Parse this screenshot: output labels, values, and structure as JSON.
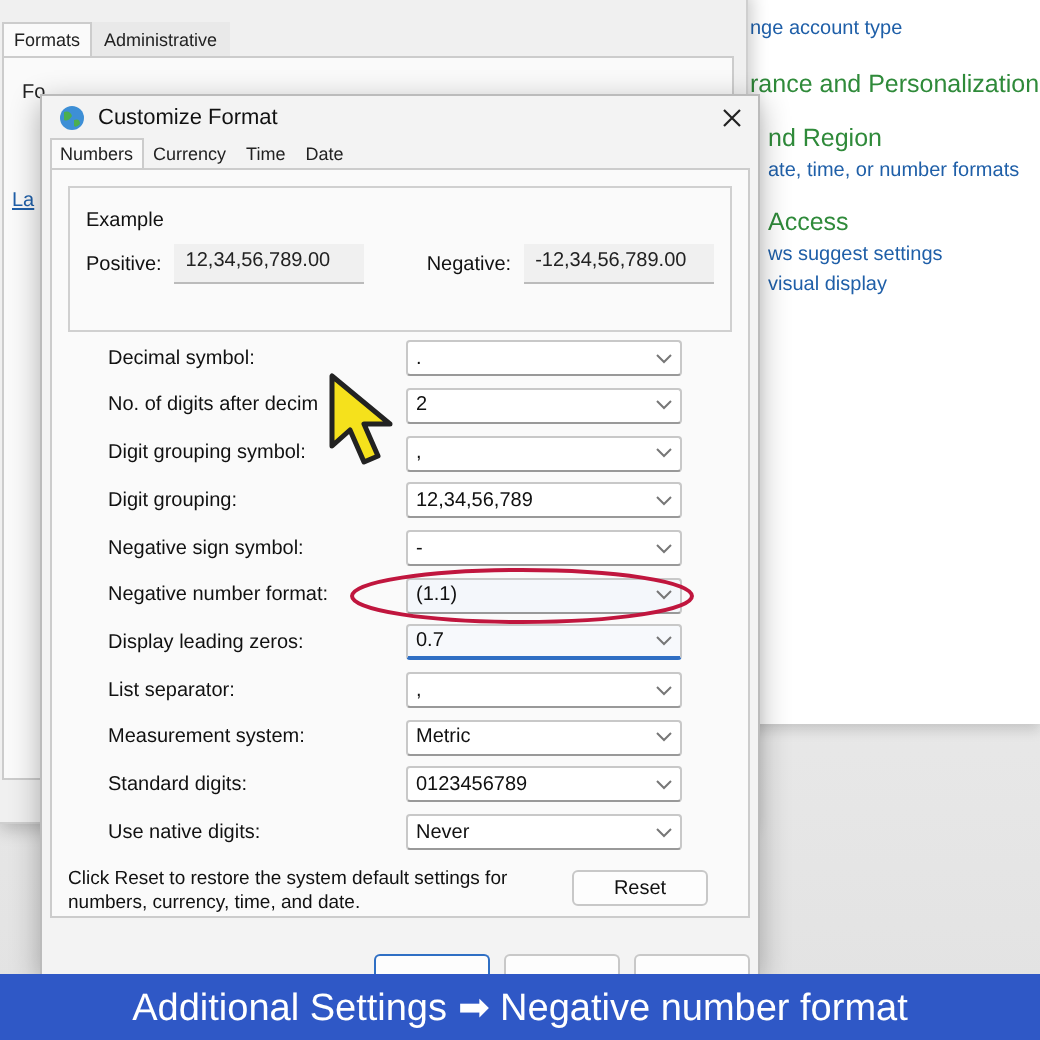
{
  "control_panel": {
    "items": [
      {
        "kind": "link",
        "text": "nge account type"
      },
      {
        "kind": "heading",
        "text": "rance and Personalization"
      },
      {
        "kind": "heading",
        "text": "nd Region"
      },
      {
        "kind": "link",
        "text": "ate, time, or number formats"
      },
      {
        "kind": "heading",
        "text": "Access"
      },
      {
        "kind": "link",
        "text": "ws suggest settings"
      },
      {
        "kind": "link",
        "text": "visual display"
      }
    ]
  },
  "region_window": {
    "tabs": [
      {
        "label": "Formats",
        "selected": true
      },
      {
        "label": "Administrative",
        "selected": false
      }
    ],
    "format_label": "Fo",
    "language_link": "La"
  },
  "dialog": {
    "title": "Customize Format",
    "tabs": [
      {
        "label": "Numbers",
        "selected": true
      },
      {
        "label": "Currency",
        "selected": false
      },
      {
        "label": "Time",
        "selected": false
      },
      {
        "label": "Date",
        "selected": false
      }
    ],
    "example": {
      "title": "Example",
      "positive_label": "Positive:",
      "positive_value": "12,34,56,789.00",
      "negative_label": "Negative:",
      "negative_value": "-12,34,56,789.00"
    },
    "settings": [
      {
        "label": "Decimal symbol:",
        "value": ".",
        "focused": false,
        "highlighted": false
      },
      {
        "label": "No. of digits after decim",
        "value": "2",
        "focused": false,
        "highlighted": false
      },
      {
        "label": "Digit grouping symbol:",
        "value": ",",
        "focused": false,
        "highlighted": false
      },
      {
        "label": "Digit grouping:",
        "value": "12,34,56,789",
        "focused": false,
        "highlighted": false
      },
      {
        "label": "Negative sign symbol:",
        "value": "-",
        "focused": false,
        "highlighted": false
      },
      {
        "label": "Negative number format:",
        "value": "(1.1)",
        "focused": false,
        "highlighted": true
      },
      {
        "label": "Display leading zeros:",
        "value": "0.7",
        "focused": true,
        "highlighted": false
      },
      {
        "label": "List separator:",
        "value": ",",
        "focused": false,
        "highlighted": false
      },
      {
        "label": "Measurement system:",
        "value": "Metric",
        "focused": false,
        "highlighted": false
      },
      {
        "label": "Standard digits:",
        "value": "0123456789",
        "focused": false,
        "highlighted": false
      },
      {
        "label": "Use native digits:",
        "value": "Never",
        "focused": false,
        "highlighted": false
      }
    ],
    "note": "Click Reset to restore the system default settings for numbers, currency, time, and date.",
    "reset_button": "Reset"
  },
  "caption": {
    "text": "Additional Settings ➡ Negative number format"
  }
}
